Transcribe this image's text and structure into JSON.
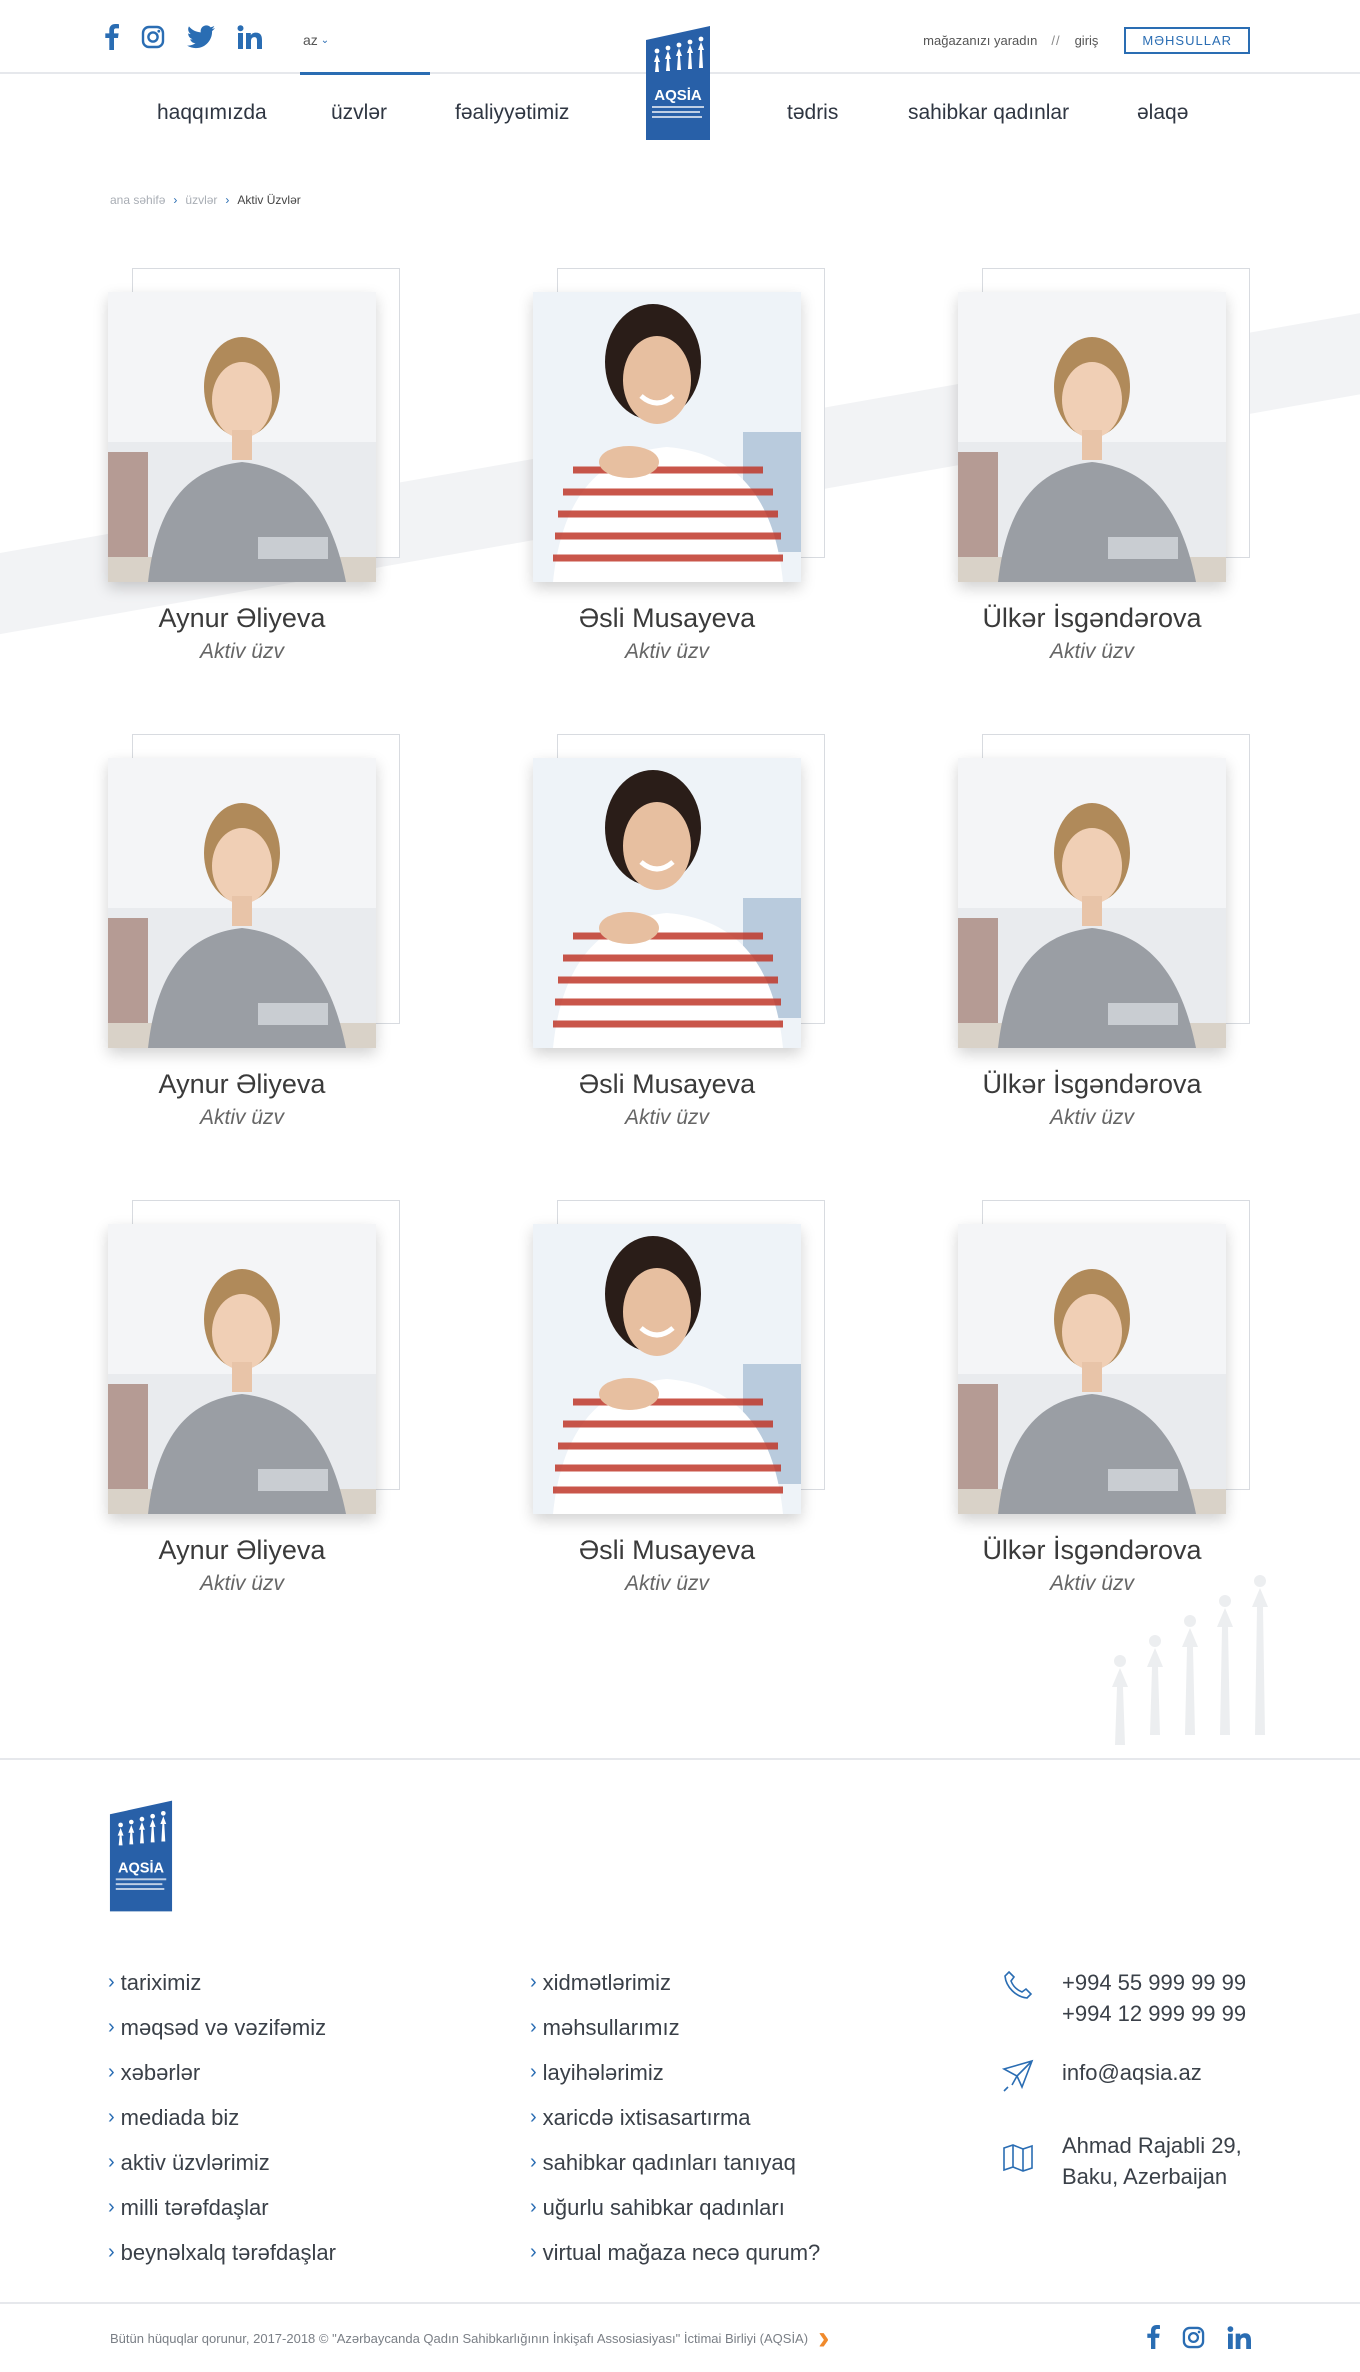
{
  "header": {
    "lang": "az",
    "create_store": "mağazanızı yaradın",
    "separator": "//",
    "login": "giriş",
    "products_button": "MƏHSULLAR",
    "socials": [
      "facebook-icon",
      "instagram-icon",
      "twitter-icon",
      "linkedin-icon"
    ]
  },
  "nav": {
    "items": [
      "haqqımızda",
      "üzvlər",
      "fəaliyyətimiz",
      "tədris",
      "sahibkar qadınlar",
      "əlaqə"
    ],
    "active": "üzvlər"
  },
  "logo": {
    "title": "AQSİA",
    "subtitle": "Azərbaycanda Qadın Sahibkarlığının İnkişafı Assosiasiyası"
  },
  "breadcrumb": {
    "home": "ana səhifə",
    "section": "üzvlər",
    "current": "Aktiv Üzvlər"
  },
  "members": [
    {
      "name": "Aynur Əliyeva",
      "role": "Aktiv üzv",
      "photo": "blonde"
    },
    {
      "name": "Əsli Musayeva",
      "role": "Aktiv üzv",
      "photo": "brunette"
    },
    {
      "name": "Ülkər İsgəndərova",
      "role": "Aktiv üzv",
      "photo": "blonde"
    },
    {
      "name": "Aynur Əliyeva",
      "role": "Aktiv üzv",
      "photo": "blonde"
    },
    {
      "name": "Əsli Musayeva",
      "role": "Aktiv üzv",
      "photo": "brunette"
    },
    {
      "name": "Ülkər İsgəndərova",
      "role": "Aktiv üzv",
      "photo": "blonde"
    },
    {
      "name": "Aynur Əliyeva",
      "role": "Aktiv üzv",
      "photo": "blonde"
    },
    {
      "name": "Əsli Musayeva",
      "role": "Aktiv üzv",
      "photo": "brunette"
    },
    {
      "name": "Ülkər İsgəndərova",
      "role": "Aktiv üzv",
      "photo": "blonde"
    }
  ],
  "footer": {
    "col1": [
      "tariximiz",
      "məqsəd və vəzifəmiz",
      "xəbərlər",
      "mediada biz",
      "aktiv üzvlərimiz",
      "milli tərəfdaşlar",
      "beynəlxalq tərəfdaşlar"
    ],
    "col2": [
      "xidmətlərimiz",
      "məhsullarımız",
      "layihələrimiz",
      "xaricdə ixtisasartırma",
      "sahibkar qadınları tanıyaq",
      "uğurlu sahibkar qadınları",
      "virtual mağaza necə qurum?"
    ],
    "phones": [
      "+994 55 999 99 99",
      "+994 12 999 99 99"
    ],
    "email": "info@aqsia.az",
    "address": [
      "Ahmad Rajabli 29,",
      "Baku, Azerbaijan"
    ],
    "copyright": "Bütün hüquqlar qorunur, 2017-2018 © \"Azərbaycanda Qadın Sahibkarlığının İnkişafı Assosiasiyası\" İctimai Birliyi (AQSİA)"
  },
  "colors": {
    "accent": "#2a6db3",
    "arrow": "#f08a2c",
    "text": "#3a3a3a"
  }
}
